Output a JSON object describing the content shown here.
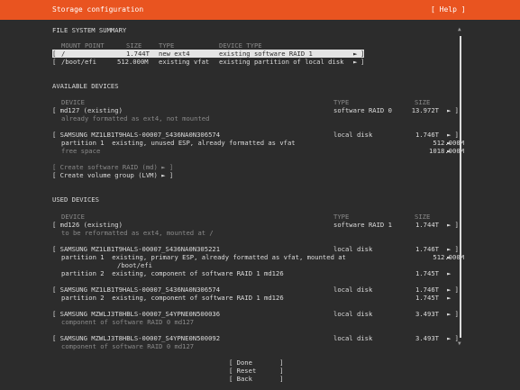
{
  "window": {
    "title": "Storage configuration",
    "help": "[ Help ]"
  },
  "fs_summary": {
    "heading": "FILE SYSTEM SUMMARY",
    "columns": [
      "MOUNT POINT",
      "SIZE",
      "TYPE",
      "DEVICE TYPE"
    ],
    "rows": [
      {
        "bracket": "[",
        "mount": "/",
        "size": "1.744T",
        "type": "new ext4",
        "device": "existing software RAID 1",
        "arrow": "►",
        "close": "]"
      },
      {
        "bracket": "[",
        "mount": "/boot/efi",
        "size": "512.000M",
        "type": "existing vfat",
        "device": "existing partition of local disk",
        "arrow": "►",
        "close": "]"
      }
    ]
  },
  "available": {
    "heading": "AVAILABLE DEVICES",
    "col_device": "DEVICE",
    "col_type": "TYPE",
    "col_size": "SIZE",
    "md127": {
      "name": "[ md127 (existing)",
      "type": "software RAID 0",
      "size": "13.972T",
      "arrow": "► ]",
      "note": "already formatted as ext4, not mounted"
    },
    "disk": {
      "name": "[ SAMSUNG MZ1LB1T9HALS-00007_S436NA0N306574",
      "type": "local disk",
      "size": "1.746T",
      "arrow": "► ]"
    },
    "part1": {
      "name": "partition 1  existing, unused ESP, already formatted as vfat",
      "size": "512.000M",
      "arrow": "►"
    },
    "free": {
      "name": "free space",
      "size": "1018.000M",
      "arrow": "►"
    },
    "create_raid": "[ Create software RAID (md) ► ]",
    "create_lvm": "[ Create volume group (LVM) ► ]"
  },
  "used": {
    "heading": "USED DEVICES",
    "col_device": "DEVICE",
    "col_type": "TYPE",
    "col_size": "SIZE",
    "md126": {
      "name": "[ md126 (existing)",
      "type": "software RAID 1",
      "size": "1.744T",
      "arrow": "► ]",
      "note": "to be reformatted as ext4, mounted at /"
    },
    "disk1": {
      "name": "[ SAMSUNG MZ1LB1T9HALS-00007_S436NA0N305221",
      "type": "local disk",
      "size": "1.746T",
      "arrow": "► ]"
    },
    "d1p1a": {
      "name": "partition 1  existing, primary ESP, already formatted as vfat, mounted at",
      "size": "512.000M",
      "arrow": "►"
    },
    "d1p1b": {
      "name": "/boot/efi"
    },
    "d1p2": {
      "name": "partition 2  existing, component of software RAID 1 md126",
      "size": "1.745T",
      "arrow": "►"
    },
    "disk2": {
      "name": "[ SAMSUNG MZ1LB1T9HALS-00007_S436NA0N306574",
      "type": "local disk",
      "size": "1.746T",
      "arrow": "► ]"
    },
    "d2p2": {
      "name": "partition 2  existing, component of software RAID 1 md126",
      "size": "1.745T",
      "arrow": "►"
    },
    "disk3": {
      "name": "[ SAMSUNG MZWLJ3T8HBLS-00007_S4YPNE0N500036",
      "type": "local disk",
      "size": "3.493T",
      "arrow": "► ]",
      "note": "component of software RAID 0 md127"
    },
    "disk4": {
      "name": "[ SAMSUNG MZWLJ3T8HBLS-00007_S4YPNE0N500092",
      "type": "local disk",
      "size": "3.493T",
      "arrow": "► ]",
      "note": "component of software RAID 0 md127"
    }
  },
  "buttons": {
    "done": "[ Done       ]",
    "reset": "[ Reset      ]",
    "back": "[ Back       ]"
  },
  "scroll": {
    "up": "▲",
    "down": "▼"
  }
}
